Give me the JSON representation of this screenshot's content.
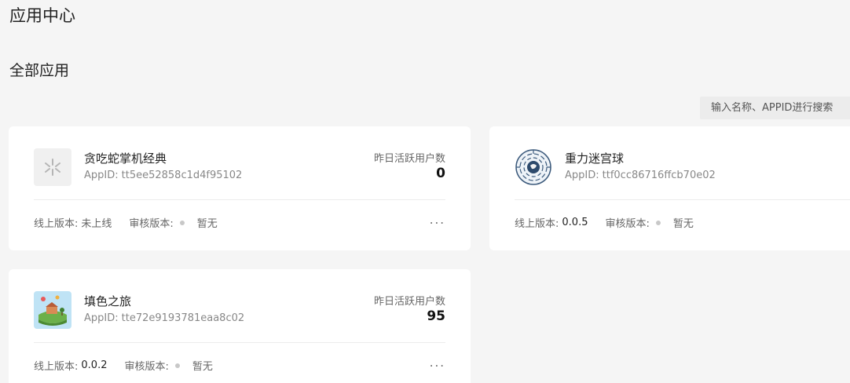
{
  "page": {
    "title": "应用中心",
    "section_title": "全部应用",
    "search_placeholder": "输入名称、APPID进行搜索"
  },
  "labels": {
    "appid": "AppID:",
    "dau": "昨日活跃用户数",
    "online_version": "线上版本:",
    "audit_version": "审核版本:",
    "more": "..."
  },
  "apps": [
    {
      "name": "贪吃蛇掌机经典",
      "appid": "tt5ee52858c1d4f95102",
      "dau": "0",
      "online_version": "未上线",
      "audit_version": "暂无",
      "icon": "placeholder-spark-icon"
    },
    {
      "name": "重力迷宫球",
      "appid": "ttf0cc86716ffcb70e02",
      "dau": "",
      "online_version": "0.0.5",
      "audit_version": "暂无",
      "icon": "maze-globe-icon"
    },
    {
      "name": "填色之旅",
      "appid": "tte72e9193781eaa8c02",
      "dau": "95",
      "online_version": "0.0.2",
      "audit_version": "暂无",
      "icon": "island-globe-icon"
    }
  ]
}
